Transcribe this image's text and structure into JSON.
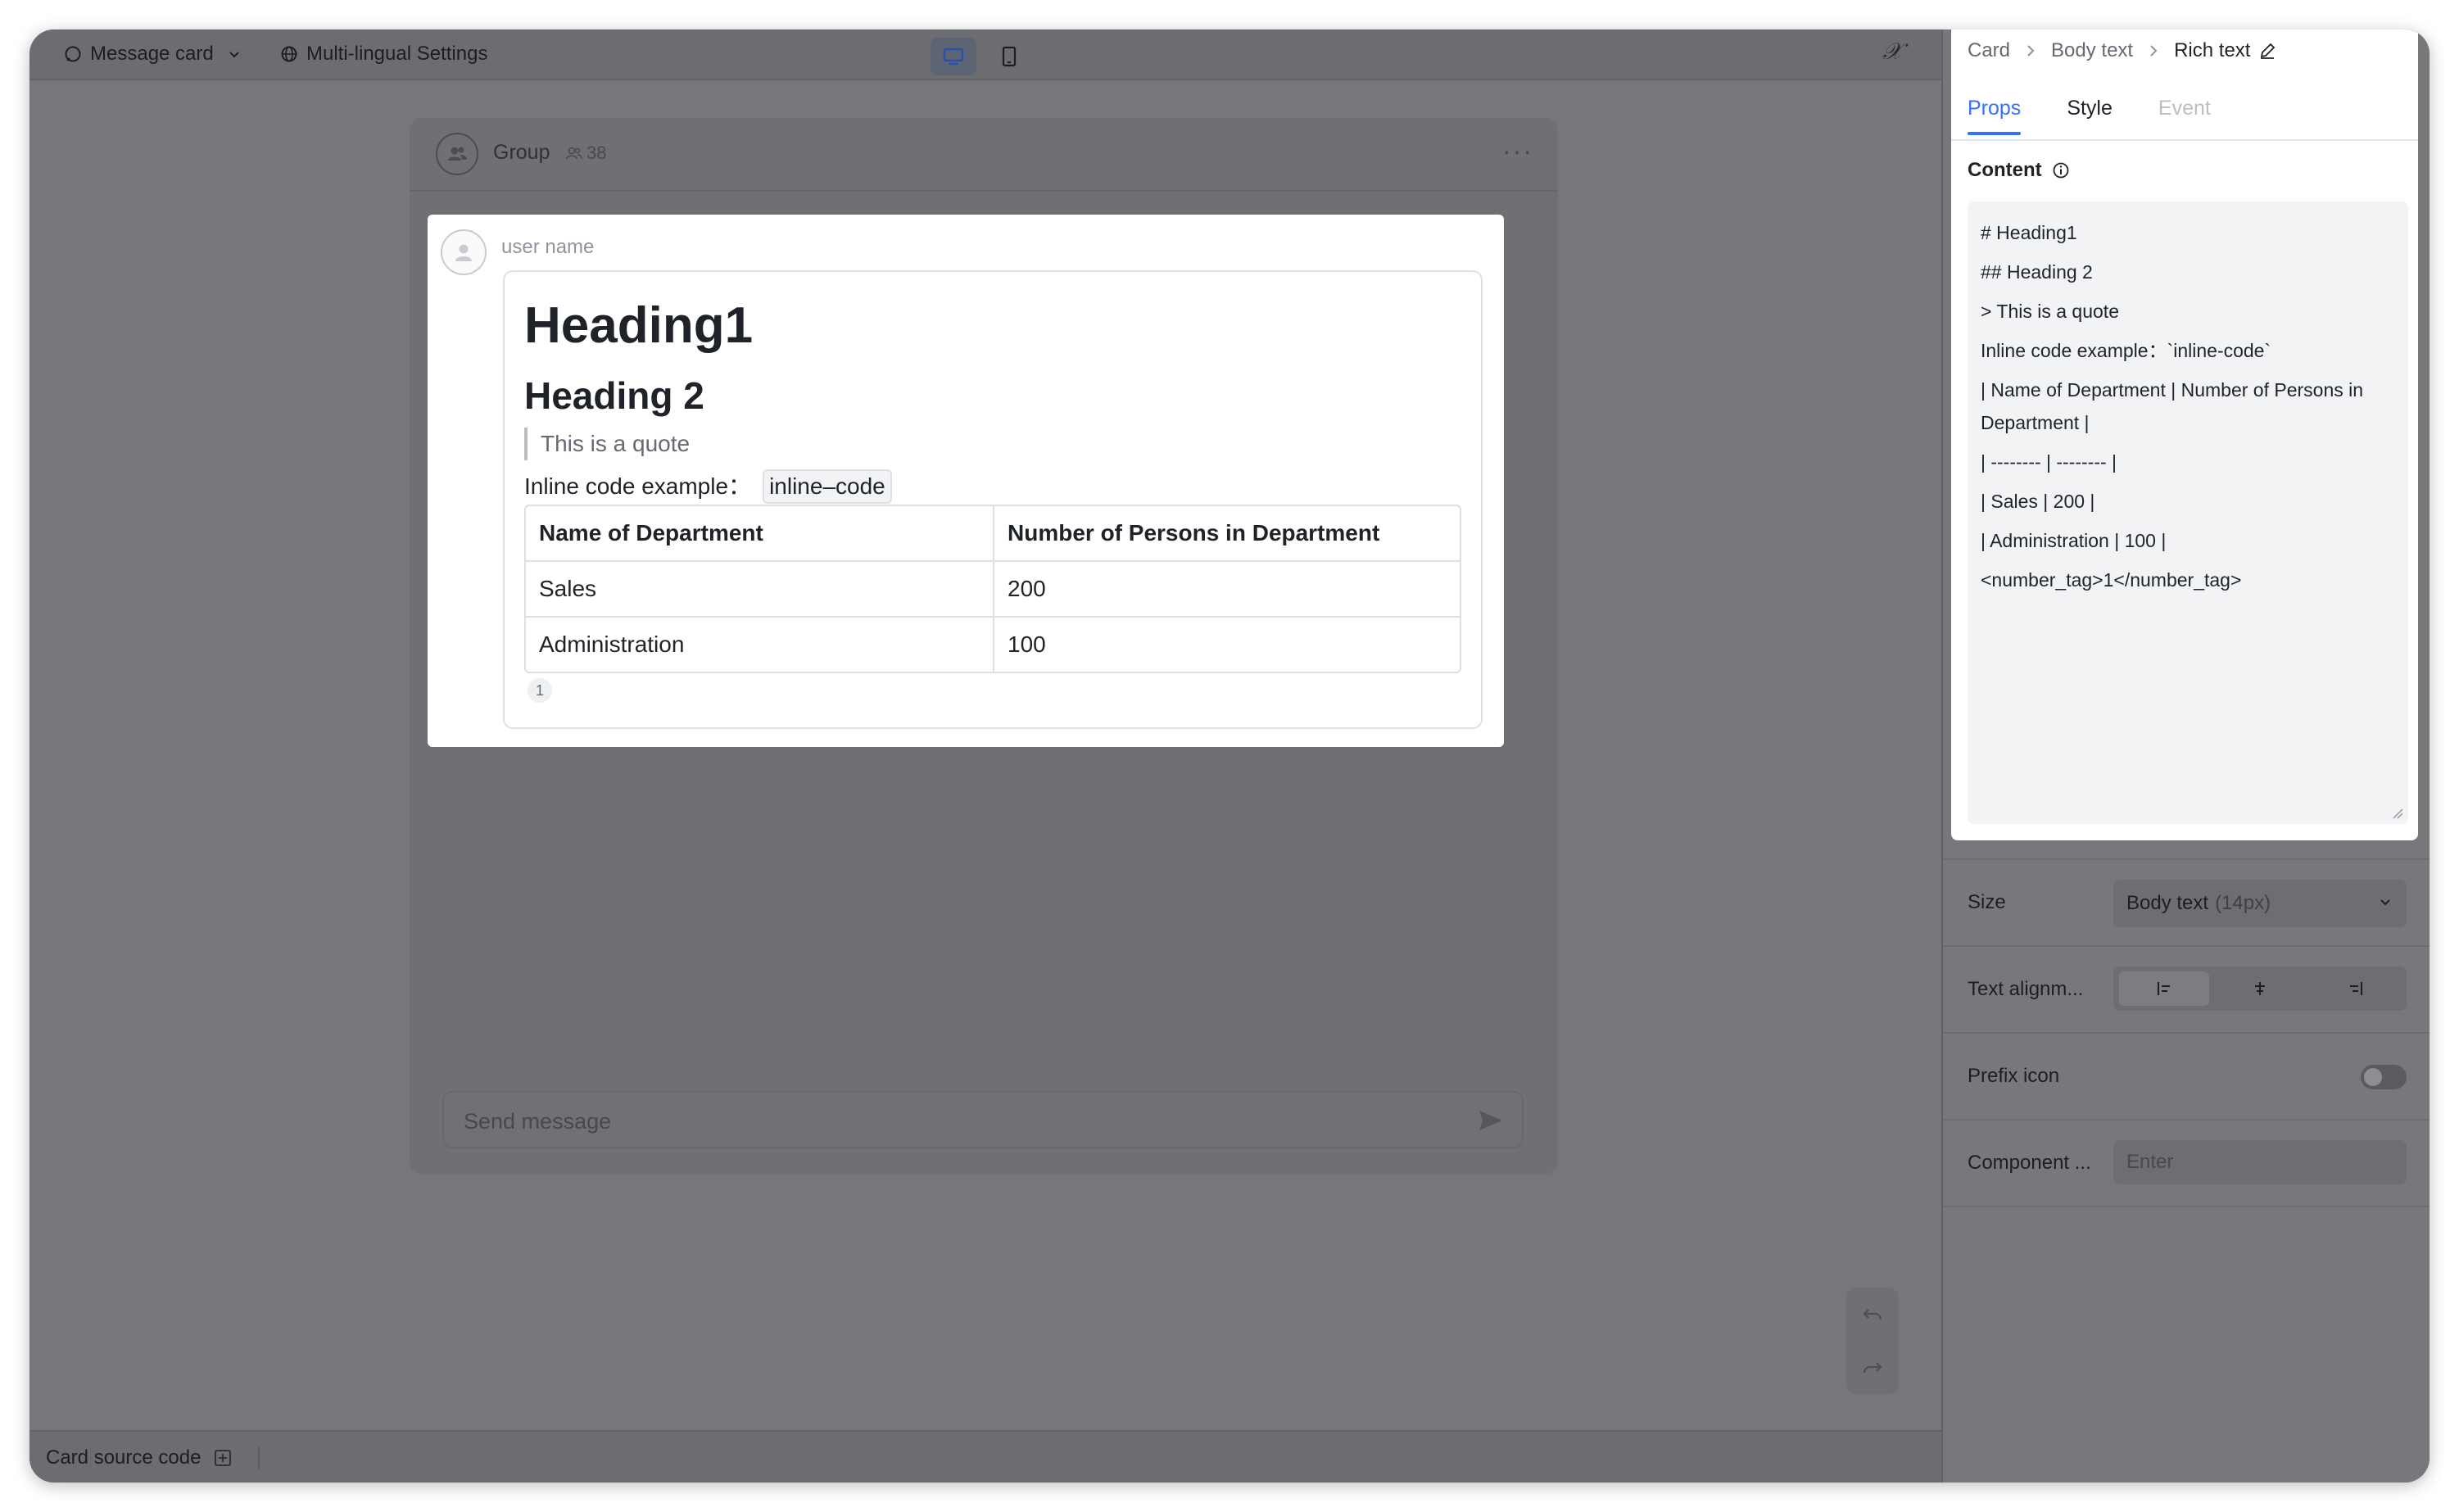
{
  "toolbar": {
    "message_card_label": "Message card",
    "multilingual_label": "Multi-lingual Settings",
    "fx_label": "𝒳"
  },
  "chat": {
    "group_name": "Group",
    "member_count": "38",
    "more_label": "···",
    "user_name": "user name",
    "send_placeholder": "Send message"
  },
  "card": {
    "heading1": "Heading1",
    "heading2": "Heading 2",
    "quote": "This is a quote",
    "inline_prefix": "Inline code example：",
    "inline_code": "inline–code",
    "table": {
      "headers": [
        "Name of Department",
        "Number of Persons in Department"
      ],
      "rows": [
        [
          "Sales",
          "200"
        ],
        [
          "Administration",
          "100"
        ]
      ]
    },
    "number_tag": "1"
  },
  "bottombar": {
    "source_label": "Card source code"
  },
  "panel": {
    "breadcrumb": [
      "Card",
      "Body text",
      "Rich text"
    ],
    "tabs": [
      "Props",
      "Style",
      "Event"
    ],
    "content_label": "Content",
    "editor_lines": [
      "# Heading1",
      "## Heading 2",
      "",
      "> This is a quote",
      "",
      "Inline code example：`inline-code`",
      "",
      "| Name of Department | Number of Persons in Department |",
      "| -------- | -------- |",
      "| Sales | 200 |",
      "| Administration | 100 |",
      "",
      "",
      "<number_tag>1</number_tag>"
    ],
    "size_label": "Size",
    "size_value": "Body text",
    "size_hint": "(14px)",
    "align_label": "Text alignm...",
    "prefix_label": "Prefix icon",
    "component_label": "Component ...",
    "component_placeholder": "Enter"
  },
  "colors": {
    "accent": "#3370ff",
    "overlay": "#76777a"
  }
}
